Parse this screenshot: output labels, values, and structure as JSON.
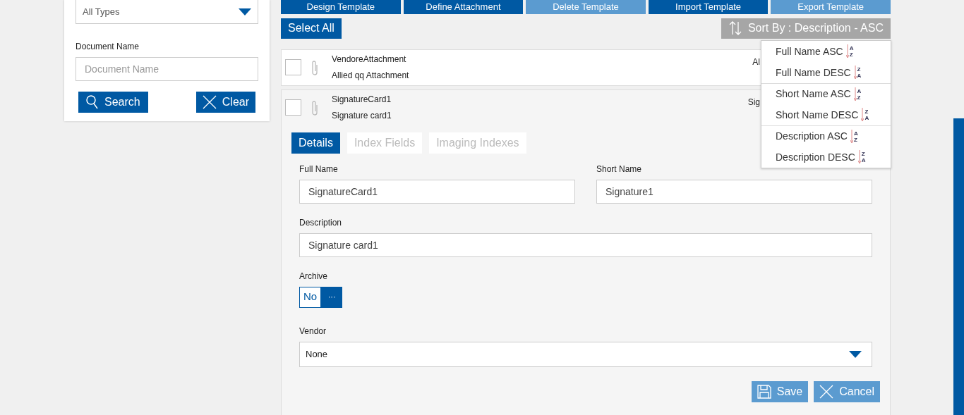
{
  "toolbar": [
    {
      "label": "Design Template",
      "disabled": false
    },
    {
      "label": "Define Attachment",
      "disabled": false
    },
    {
      "label": "Delete Template",
      "disabled": true
    },
    {
      "label": "Import Template",
      "disabled": false
    },
    {
      "label": "Export Template",
      "disabled": true
    }
  ],
  "filters": {
    "type_select": {
      "value": "All Types"
    },
    "name_label": "Document Name",
    "name_field": {
      "placeholder": "Document Name"
    },
    "search_button": "Search",
    "clear_button": "Clear"
  },
  "select_all": "Select All",
  "sort_button": "Sort By : Description - ASC",
  "sort_menu": [
    {
      "label": "Full Name ASC",
      "top": "A",
      "bottom": "Z",
      "group_start": false
    },
    {
      "label": "Full Name DESC",
      "top": "Z",
      "bottom": "A",
      "group_start": false
    },
    {
      "label": "Short Name ASC",
      "top": "A",
      "bottom": "Z",
      "group_start": true
    },
    {
      "label": "Short Name DESC",
      "top": "Z",
      "bottom": "A",
      "group_start": false
    },
    {
      "label": "Description ASC",
      "top": "A",
      "bottom": "Z",
      "group_start": true
    },
    {
      "label": "Description DESC",
      "top": "Z",
      "bottom": "A",
      "group_start": false
    }
  ],
  "rows": [
    {
      "name": "VendoreAttachment",
      "description": "Allied qq Attachment",
      "right_text": "Al",
      "checked": false,
      "expanded": false
    },
    {
      "name": "SignatureCard1",
      "description": "Signature card1",
      "right_text": "Sig",
      "checked": false,
      "expanded": true
    }
  ],
  "details": {
    "tabs": [
      {
        "label": "Details",
        "selected": true
      },
      {
        "label": "Index Fields",
        "selected": false
      },
      {
        "label": "Imaging Indexes",
        "selected": false
      }
    ],
    "full_name_label": "Full Name",
    "full_name": "SignatureCard1",
    "short_name_label": "Short Name",
    "short_name": "Signature1",
    "description_label": "Description",
    "description": "Signature card1",
    "archive_label": "Archive",
    "archive_value": "No",
    "archive_button": "···",
    "vendor_label": "Vendor",
    "vendor": "None",
    "save_button": "Save",
    "cancel_button": "Cancel"
  }
}
